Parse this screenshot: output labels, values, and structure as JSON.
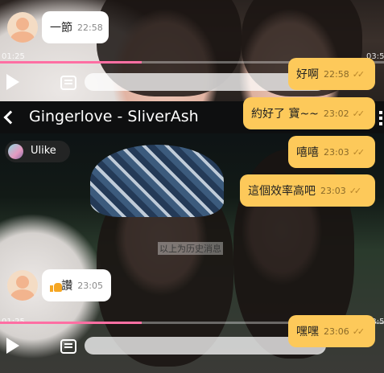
{
  "video": {
    "title": "Gingerlove - SliverAsh",
    "channel": "Ulike",
    "top_time_left": "01:25",
    "top_time_right": "03:5",
    "bottom_time_left": "01:25",
    "bottom_time_right": "03:5",
    "progress_fraction": 0.37,
    "accent_color": "#ff6fa3"
  },
  "chat": {
    "history_note": "以上为历史消息",
    "messages": [
      {
        "side": "in",
        "text": "一節",
        "time": "22:58"
      },
      {
        "side": "out",
        "text": "好啊",
        "time": "22:58"
      },
      {
        "side": "out",
        "text": "約好了 寶~~",
        "time": "23:02"
      },
      {
        "side": "out",
        "text": "嘻嘻",
        "time": "23:03"
      },
      {
        "side": "out",
        "text": "這個效率高吧",
        "time": "23:03"
      },
      {
        "side": "in",
        "text": "讚",
        "time": "23:05",
        "icon": "thumbs-up-icon"
      },
      {
        "side": "out",
        "text": "嘿嘿",
        "time": "23:06"
      }
    ],
    "read_mark": "✓✓",
    "colors": {
      "incoming": "#ffffff",
      "outgoing": "#fdc95a"
    }
  }
}
